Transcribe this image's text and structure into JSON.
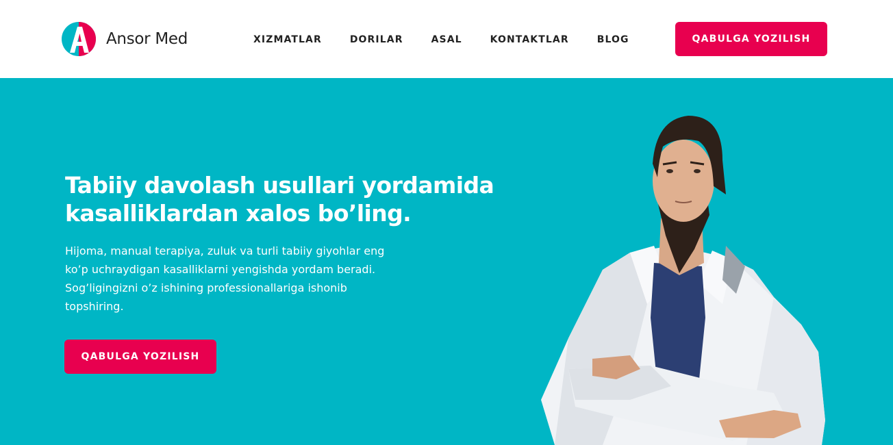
{
  "brand": {
    "name": "Ansor Med",
    "logo_letter": "A",
    "colors": {
      "accent": "#e8004f",
      "teal": "#00b6c5"
    }
  },
  "nav": {
    "items": [
      {
        "label": "XIZMATLAR"
      },
      {
        "label": "DORILAR"
      },
      {
        "label": "ASAL"
      },
      {
        "label": "KONTAKTLAR"
      },
      {
        "label": "BLOG"
      }
    ]
  },
  "header": {
    "cta_label": "QABULGA YOZILISH"
  },
  "hero": {
    "title": "Tabiiy davolash usullari yordamida kasalliklardan xalos bo’ling.",
    "description": "Hijoma, manual terapiya, zuluk va turli tabiiy giyohlar eng ko’p uchraydigan kasalliklarni yengishda yordam beradi. Sog’ligingizni o’z ishining professionallariga ishonib topshiring.",
    "cta_label": "QABULGA YOZILISH",
    "image": "doctor-portrait-illustration"
  }
}
